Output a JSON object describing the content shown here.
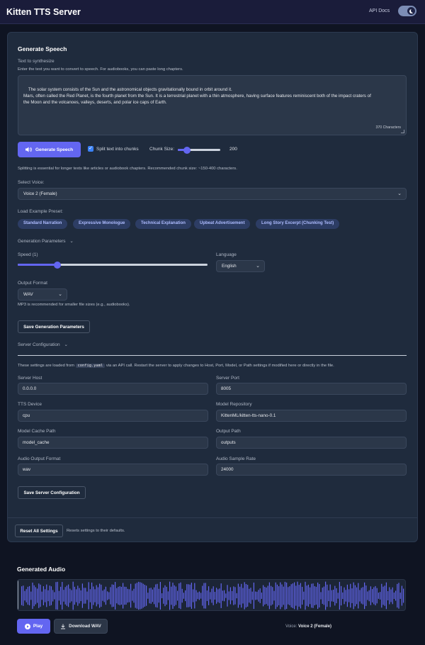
{
  "header": {
    "title": "Kitten TTS Server",
    "api_docs": "API Docs"
  },
  "generate": {
    "heading": "Generate Speech",
    "text_label": "Text to synthesize",
    "text_help": "Enter the text you want to convert to speech. For audiobooks, you can paste long chapters.",
    "text_value": "The solar system consists of the Sun and the astronomical objects gravitationally bound in orbit around it.\nMars, often called the Red Planet, is the fourth planet from the Sun. It is a terrestrial planet with a thin atmosphere, having surface features reminiscent both of the impact craters of\nthe Moon and the volcanoes, valleys, deserts, and polar ice caps of Earth.",
    "char_count": "370 Characters",
    "button": "Generate Speech",
    "split_label": "Split text into chunks",
    "split_checked": true,
    "chunk_label": "Chunk Size:",
    "chunk_value": "200",
    "chunk_fraction": 0.22,
    "split_help": "Splitting is essential for longer texts like articles or audiobook chapters. Recommended chunk size: ~150-400 characters."
  },
  "voice": {
    "label": "Select Voice:",
    "value": "Voice 2 (Female)"
  },
  "presets": {
    "label": "Load Example Preset:",
    "items": [
      "Standard Narration",
      "Expressive Monologue",
      "Technical Explanation",
      "Upbeat Advertisement",
      "Long Story Excerpt (Chunking Test)"
    ]
  },
  "params": {
    "heading": "Generation Parameters",
    "speed_label": "Speed (1)",
    "speed_fraction": 0.21,
    "language_label": "Language",
    "language_value": "English",
    "format_label": "Output Format",
    "format_value": "WAV",
    "format_help": "MP3 is recommended for smaller file sizes (e.g., audiobooks).",
    "save_button": "Save Generation Parameters"
  },
  "server": {
    "heading": "Server Configuration",
    "note_before": "These settings are loaded from",
    "note_code": "config.yaml",
    "note_after": "via an API call. Restart the server to apply changes to Host, Port, Model, or Path settings if modified here or directly in the file.",
    "host_label": "Server Host",
    "host_value": "0.0.0.0",
    "port_label": "Server Port",
    "port_value": "8005",
    "device_label": "TTS Device",
    "device_value": "cpu",
    "repo_label": "Model Repository",
    "repo_value": "KittenML/kitten-tts-nano-0.1",
    "cache_label": "Model Cache Path",
    "cache_value": "model_cache",
    "output_label": "Output Path",
    "output_value": "outputs",
    "audio_format_label": "Audio Output Format",
    "audio_format_value": "wav",
    "sample_rate_label": "Audio Sample Rate",
    "sample_rate_value": "24000",
    "save_button": "Save Server Configuration"
  },
  "reset": {
    "button": "Reset All Settings",
    "help": "Resets settings to their defaults."
  },
  "output": {
    "heading": "Generated Audio",
    "play": "Play",
    "download": "Download WAV",
    "voice_prefix": "Voice:",
    "voice_value": "Voice 2 (Female)"
  },
  "colors": {
    "accent": "#6366f1",
    "background": "#0f1422",
    "card": "#1f2b3d",
    "wave": "#6366f1"
  }
}
